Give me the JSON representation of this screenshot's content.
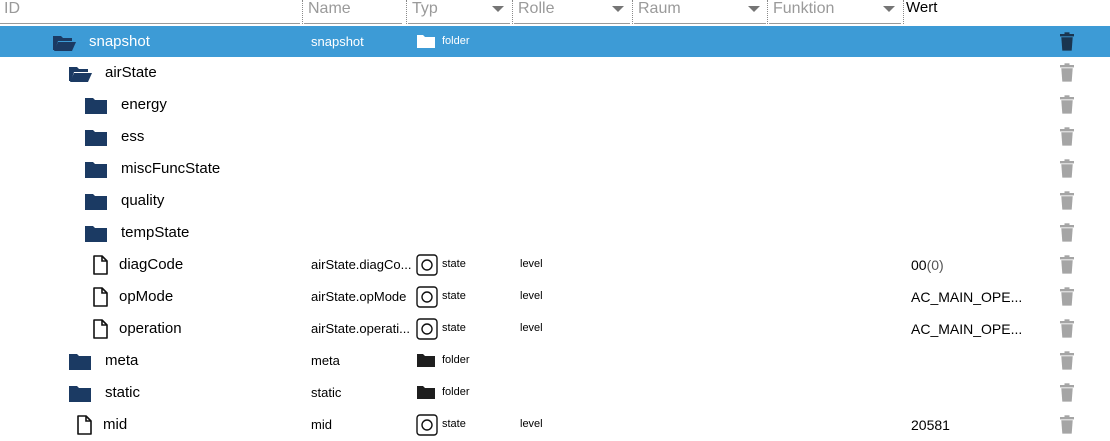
{
  "header": {
    "id_placeholder": "ID",
    "name_placeholder": "Name",
    "type_label": "Typ",
    "role_label": "Rolle",
    "room_label": "Raum",
    "function_label": "Funktion",
    "value_label": "Wert"
  },
  "rows": [
    {
      "label": "snapshot",
      "name": "snapshot",
      "type": "folder",
      "role": "",
      "value": "",
      "value_q": "",
      "icon": "folder-open-icon",
      "selected": true
    },
    {
      "label": "airState",
      "name": "",
      "type": "",
      "role": "",
      "value": "",
      "value_q": "",
      "icon": "folder-open-icon"
    },
    {
      "label": "energy",
      "name": "",
      "type": "",
      "role": "",
      "value": "",
      "value_q": "",
      "icon": "folder-icon"
    },
    {
      "label": "ess",
      "name": "",
      "type": "",
      "role": "",
      "value": "",
      "value_q": "",
      "icon": "folder-icon"
    },
    {
      "label": "miscFuncState",
      "name": "",
      "type": "",
      "role": "",
      "value": "",
      "value_q": "",
      "icon": "folder-icon"
    },
    {
      "label": "quality",
      "name": "",
      "type": "",
      "role": "",
      "value": "",
      "value_q": "",
      "icon": "folder-icon"
    },
    {
      "label": "tempState",
      "name": "",
      "type": "",
      "role": "",
      "value": "",
      "value_q": "",
      "icon": "folder-icon"
    },
    {
      "label": "diagCode",
      "name": "airState.diagCo...",
      "type": "state",
      "role": "level",
      "value": "00",
      "value_q": "(0)",
      "icon": "file-icon"
    },
    {
      "label": "opMode",
      "name": "airState.opMode",
      "type": "state",
      "role": "level",
      "value": "AC_MAIN_OPE...",
      "value_q": "",
      "icon": "file-icon"
    },
    {
      "label": "operation",
      "name": "airState.operati...",
      "type": "state",
      "role": "level",
      "value": "AC_MAIN_OPE...",
      "value_q": "",
      "icon": "file-icon"
    },
    {
      "label": "meta",
      "name": "meta",
      "type": "folder",
      "role": "",
      "value": "",
      "value_q": "",
      "icon": "folder-icon"
    },
    {
      "label": "static",
      "name": "static",
      "type": "folder",
      "role": "",
      "value": "",
      "value_q": "",
      "icon": "folder-icon"
    },
    {
      "label": "mid",
      "name": "mid",
      "type": "state",
      "role": "level",
      "value": "20581",
      "value_q": "",
      "icon": "file-icon"
    }
  ],
  "colors": {
    "selected_bg": "#3d9bd6",
    "folder": "#1b3a63",
    "type_folder": "#1e1e1e",
    "trash": "#a5a5a5"
  }
}
